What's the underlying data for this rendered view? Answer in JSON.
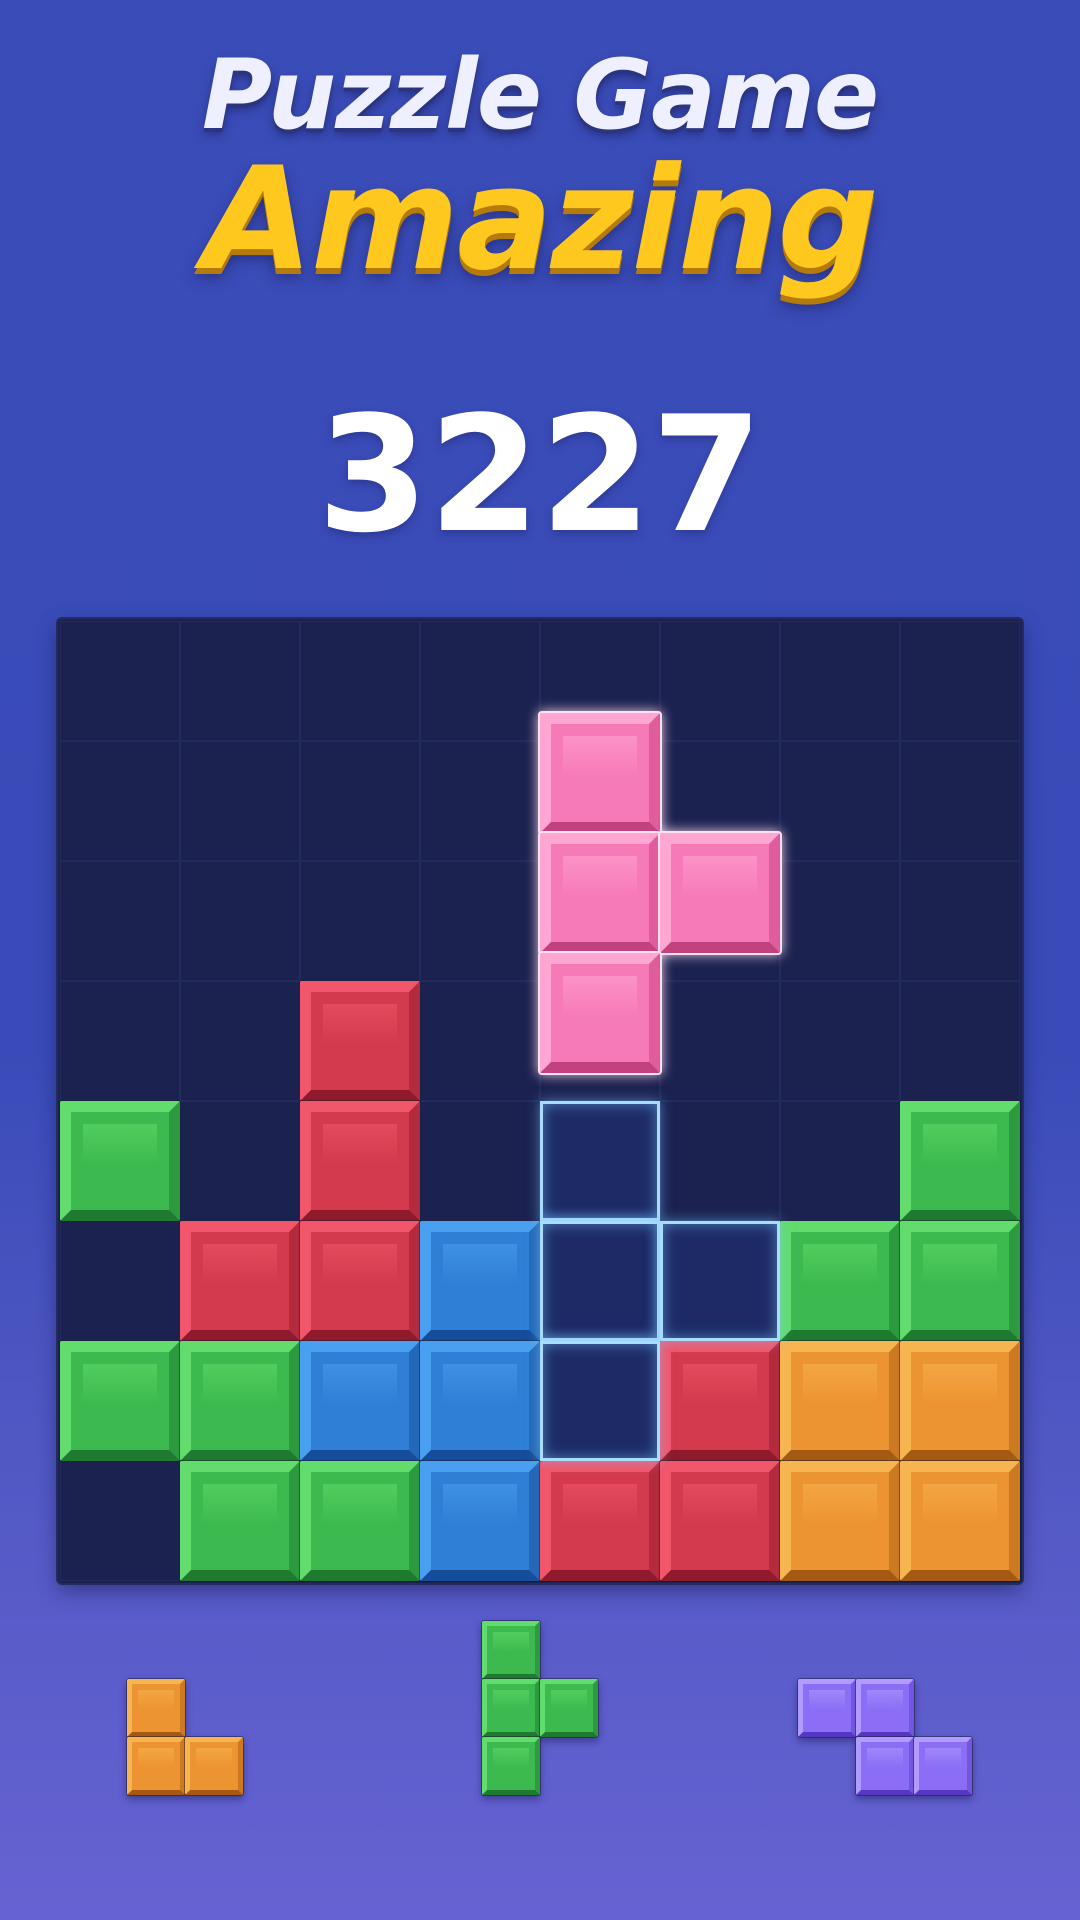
{
  "title": {
    "line1": "Puzzle Game",
    "line2": "Amazing"
  },
  "score": "3227",
  "palette": {
    "red": {
      "base": "#d43a4d",
      "light": "#f2566a",
      "dark": "#8e1a2c",
      "side": "#b32b3e"
    },
    "green": {
      "base": "#3dba4f",
      "light": "#62dc6c",
      "dark": "#1d7a2e",
      "side": "#2e9a3f"
    },
    "blue": {
      "base": "#2f7fd6",
      "light": "#4aa0f0",
      "dark": "#164d9a",
      "side": "#2468b8"
    },
    "orange": {
      "base": "#ec9431",
      "light": "#f7b552",
      "dark": "#a45a12",
      "side": "#cc7a22"
    },
    "pink": {
      "base": "#f77ab8",
      "light": "#ffa6d2",
      "dark": "#c1427f",
      "side": "#e05c9d"
    },
    "purple": {
      "base": "#8b6ef5",
      "light": "#b09bff",
      "dark": "#5537c2",
      "side": "#7256e0"
    }
  },
  "board": {
    "size": 8,
    "cells": [
      [
        "",
        "",
        "",
        "",
        "",
        "",
        "",
        ""
      ],
      [
        "",
        "",
        "",
        "",
        "",
        "",
        "",
        ""
      ],
      [
        "",
        "",
        "",
        "",
        "",
        "",
        "",
        ""
      ],
      [
        "",
        "",
        "red",
        "",
        "",
        "",
        "",
        ""
      ],
      [
        "green",
        "",
        "red",
        "",
        "",
        "",
        "",
        "green"
      ],
      [
        "",
        "red",
        "red",
        "blue",
        "",
        "",
        "green",
        "green"
      ],
      [
        "green",
        "green",
        "blue",
        "blue",
        "",
        "red",
        "orange",
        "orange"
      ],
      [
        "",
        "green",
        "green",
        "blue",
        "red",
        "red",
        "orange",
        "orange"
      ]
    ],
    "dragging_piece": {
      "color": "pink",
      "cells": [
        [
          0,
          0
        ],
        [
          1,
          0
        ],
        [
          1,
          1
        ],
        [
          2,
          0
        ]
      ]
    },
    "placement_preview_cells": [
      [
        4,
        4
      ],
      [
        5,
        4
      ],
      [
        5,
        5
      ],
      [
        6,
        4
      ]
    ]
  },
  "tray": [
    {
      "color": "orange",
      "cells": [
        [
          0,
          0
        ],
        [
          1,
          0
        ],
        [
          1,
          1
        ]
      ]
    },
    {
      "color": "green",
      "cells": [
        [
          0,
          0
        ],
        [
          1,
          0
        ],
        [
          1,
          1
        ],
        [
          2,
          0
        ]
      ]
    },
    {
      "color": "purple",
      "cells": [
        [
          0,
          0
        ],
        [
          0,
          1
        ],
        [
          1,
          1
        ],
        [
          1,
          2
        ]
      ]
    }
  ]
}
